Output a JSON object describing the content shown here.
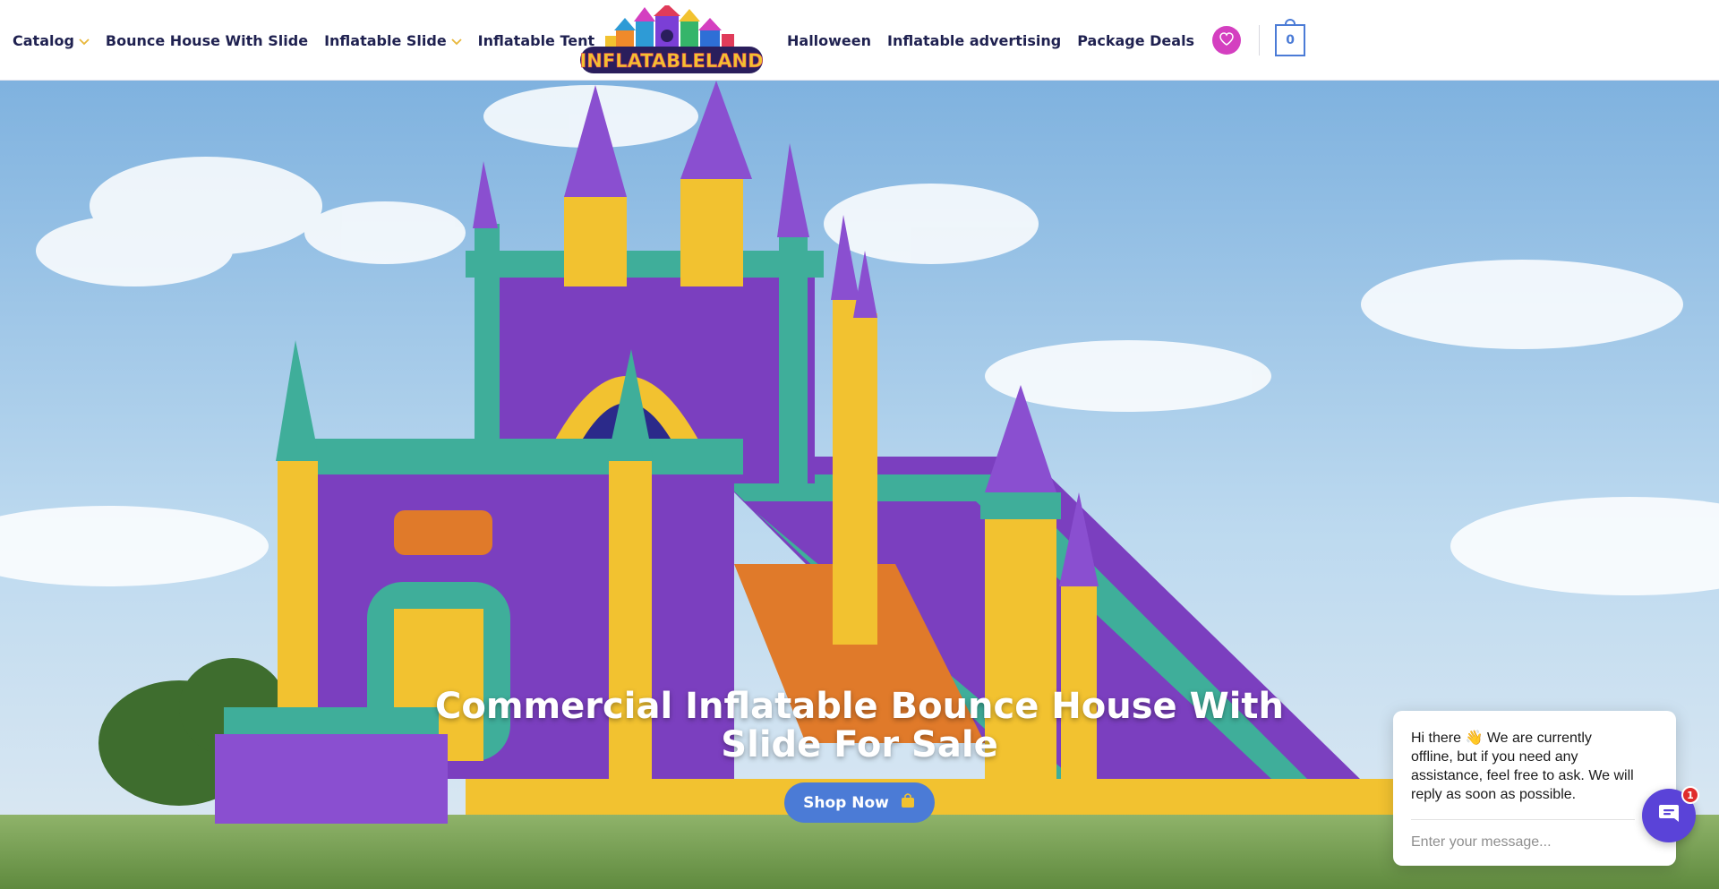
{
  "header": {
    "logo_text": "INFLATABLELAND",
    "nav_left": [
      {
        "label": "Catalog",
        "has_dropdown": true
      },
      {
        "label": "Bounce House With Slide",
        "has_dropdown": false
      },
      {
        "label": "Inflatable Slide",
        "has_dropdown": true
      },
      {
        "label": "Inflatable Tent",
        "has_dropdown": false
      }
    ],
    "nav_right": [
      {
        "label": "Halloween"
      },
      {
        "label": "Inflatable advertising"
      },
      {
        "label": "Package Deals"
      }
    ],
    "wishlist_icon": "heart-icon",
    "cart_count": "0"
  },
  "hero": {
    "title": "Commercial Inflatable Bounce House With Slide For Sale",
    "button_label": "Shop Now",
    "button_icon": "shopping-bag-icon"
  },
  "chat": {
    "message": "Hi there 👋 We are currently offline, but if you need any assistance, feel free to ask. We will reply as soon as possible.",
    "input_placeholder": "Enter your message...",
    "badge_count": "1"
  },
  "colors": {
    "nav_text": "#1f2150",
    "accent_blue": "#4b7bd6",
    "wishlist_pink": "#d43fc0",
    "chat_purple": "#5a43d8",
    "chevron_yellow": "#e8b73a"
  }
}
